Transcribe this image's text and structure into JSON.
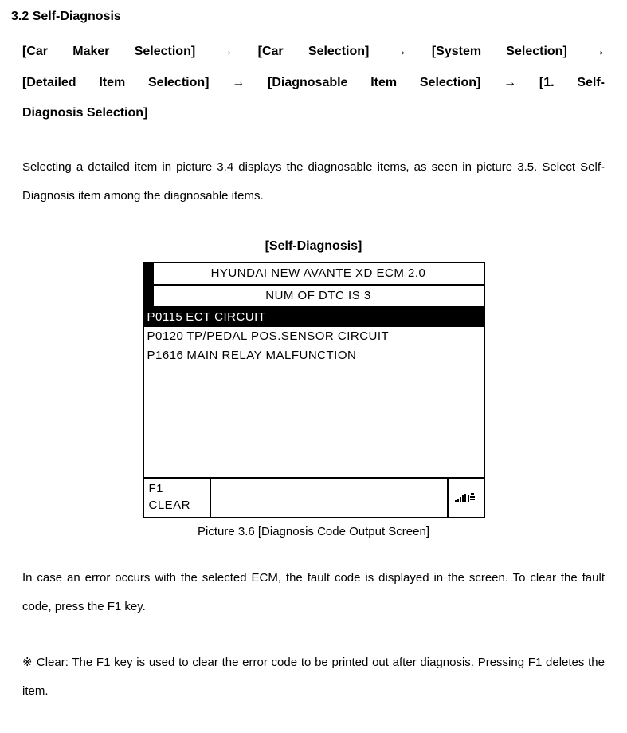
{
  "section_heading": "3.2 Self-Diagnosis",
  "breadcrumb_line1": "[Car Maker Selection] → [Car Selection] →  [System Selection] →",
  "breadcrumb_line2": "[Detailed Item Selection] → [Diagnosable Item Selection] → [1. Self-",
  "breadcrumb_line3": "Diagnosis Selection]",
  "intro_paragraph": "Selecting a detailed item in picture 3.4 displays the diagnosable items, as seen in picture 3.5. Select Self-Diagnosis item among the diagnosable items.",
  "figure_title": "[Self-Diagnosis]",
  "device": {
    "header": "HYUNDAI NEW AVANTE XD ECM 2.0",
    "subheader": "NUM OF DTC IS  3",
    "dtc": [
      {
        "code": "P0115",
        "desc": "ECT CIRCUIT",
        "selected": true
      },
      {
        "code": "P0120",
        "desc": "TP/PEDAL POS.SENSOR CIRCUIT",
        "selected": false
      },
      {
        "code": "P1616",
        "desc": "MAIN RELAY MALFUNCTION",
        "selected": false
      }
    ],
    "footer_left": "F1 CLEAR"
  },
  "caption": "Picture 3.6 [Diagnosis Code Output Screen]",
  "post_paragraph": "In case an error occurs with the selected ECM, the fault code is displayed in the screen. To clear the fault code, press the F1 key.",
  "note": "※ Clear: The F1 key is used to clear the error code to be printed out after diagnosis. Pressing F1 deletes the item."
}
